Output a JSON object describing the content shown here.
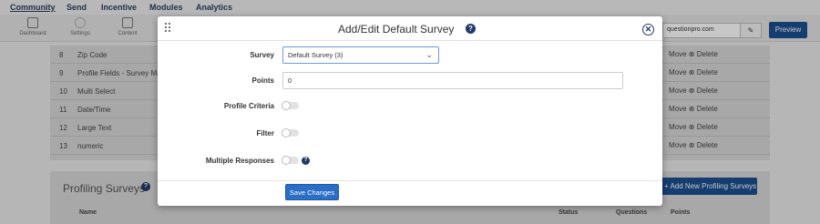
{
  "nav": {
    "community": "Community",
    "send": "Send",
    "incentive": "Incentive",
    "modules": "Modules",
    "analytics": "Analytics"
  },
  "toolbar": {
    "dashboard": "Dashboard",
    "settings": "Settings",
    "content": "Content",
    "url_value": "questionpro.com",
    "preview": "Preview"
  },
  "profile_fields": [
    {
      "num": "8",
      "name": "Zip Code"
    },
    {
      "num": "9",
      "name": "Profile Fields - Survey Map"
    },
    {
      "num": "10",
      "name": "Multi Select"
    },
    {
      "num": "11",
      "name": "Date/Time"
    },
    {
      "num": "12",
      "name": "Large Text"
    },
    {
      "num": "13",
      "name": "numeric"
    }
  ],
  "row_actions": "Move ⊗ Delete",
  "profiling_surveys": {
    "title": "Profiling Surveys",
    "add_button": "+ Add New Profiling Surveys",
    "columns": {
      "name": "Name",
      "status": "Status",
      "questions": "Questions",
      "points": "Points"
    }
  },
  "modal": {
    "title": "Add/Edit Default Survey",
    "survey_label": "Survey",
    "survey_value": "Default Survey (3)",
    "points_label": "Points",
    "points_value": "0",
    "profile_criteria_label": "Profile Criteria",
    "filter_label": "Filter",
    "multiple_responses_label": "Multiple Responses",
    "save_button": "Save Changes",
    "help_glyph": "?",
    "close_glyph": "✕"
  },
  "colors": {
    "primary": "#1b4f8f",
    "save_button": "#2a6ec6",
    "help_icon": "#1f3a66"
  }
}
